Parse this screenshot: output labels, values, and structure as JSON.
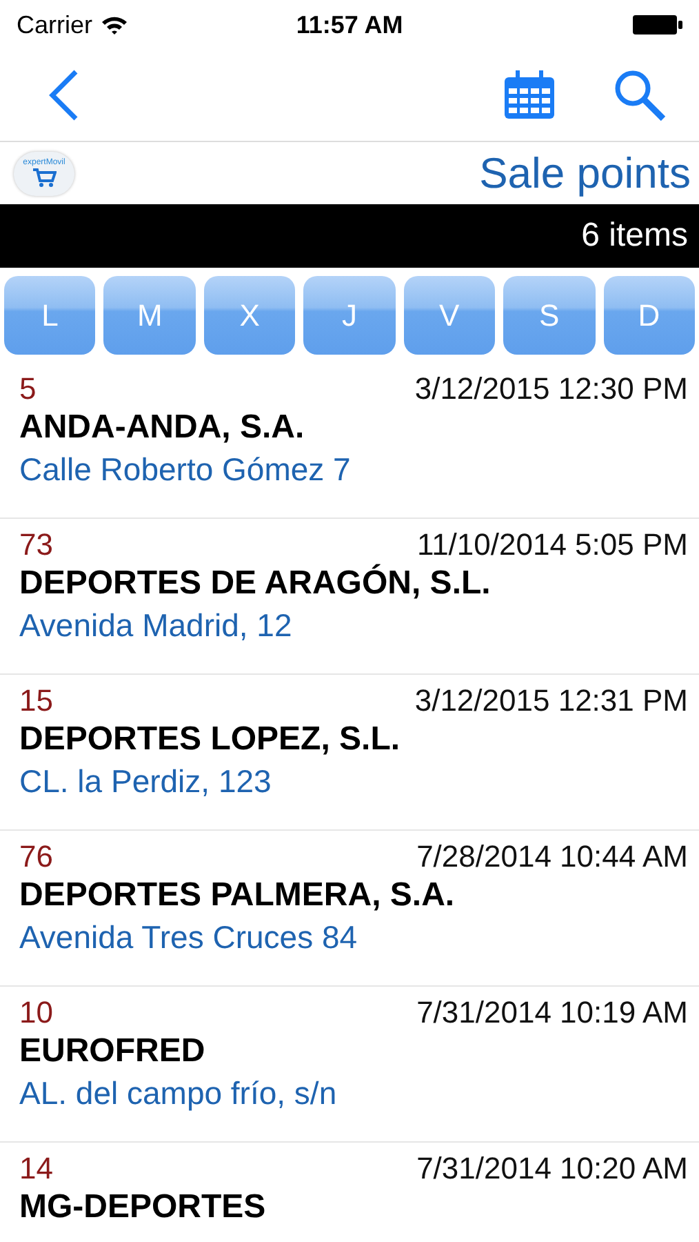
{
  "status_bar": {
    "carrier": "Carrier",
    "time": "11:57 AM"
  },
  "logo": {
    "text": "expertMovil"
  },
  "title": "Sale points",
  "count": "6 items",
  "days": [
    {
      "label": "L"
    },
    {
      "label": "M"
    },
    {
      "label": "X"
    },
    {
      "label": "J"
    },
    {
      "label": "V"
    },
    {
      "label": "S"
    },
    {
      "label": "D"
    }
  ],
  "rows": [
    {
      "code": "5",
      "date": "3/12/2015 12:30 PM",
      "name": "ANDA-ANDA, S.A.",
      "address": "Calle Roberto Gómez 7"
    },
    {
      "code": "73",
      "date": "11/10/2014 5:05 PM",
      "name": "DEPORTES DE ARAGÓN, S.L.",
      "address": "Avenida Madrid, 12"
    },
    {
      "code": "15",
      "date": "3/12/2015 12:31 PM",
      "name": "DEPORTES LOPEZ, S.L.",
      "address": "CL. la Perdiz, 123"
    },
    {
      "code": "76",
      "date": "7/28/2014 10:44 AM",
      "name": "DEPORTES PALMERA, S.A.",
      "address": "Avenida Tres Cruces 84"
    },
    {
      "code": "10",
      "date": "7/31/2014 10:19 AM",
      "name": "EUROFRED",
      "address": "AL. del campo frío, s/n"
    },
    {
      "code": "14",
      "date": "7/31/2014 10:20 AM",
      "name": "MG-DEPORTES"
    }
  ]
}
